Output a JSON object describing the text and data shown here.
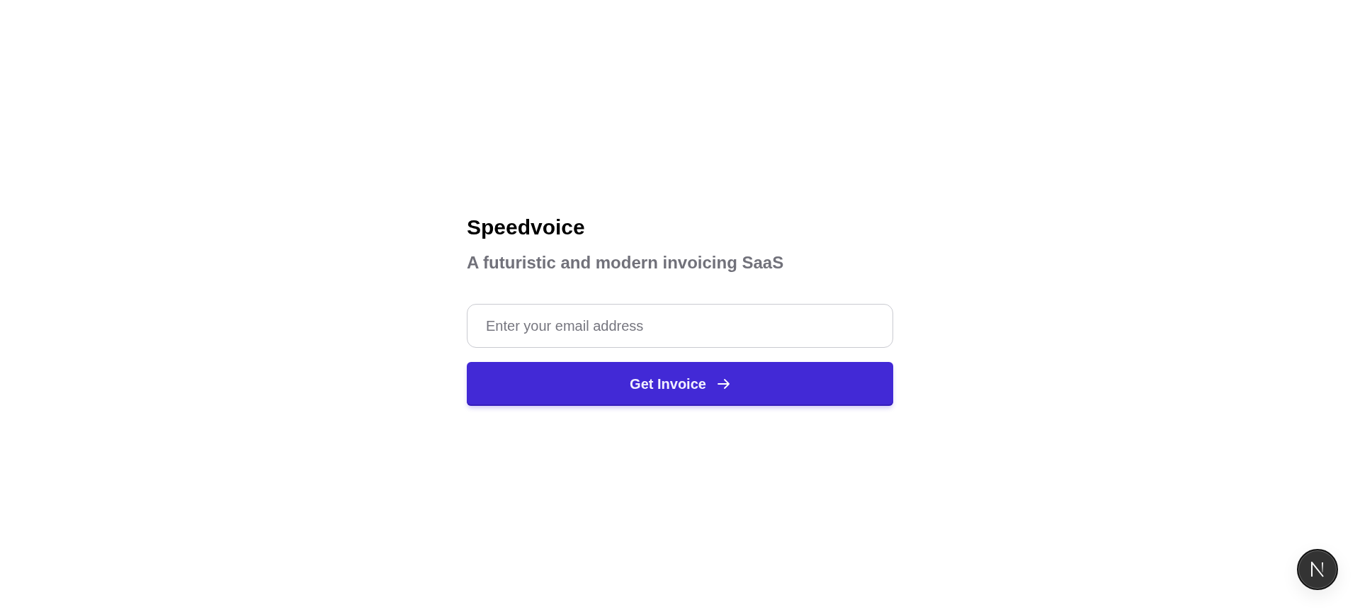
{
  "brand": {
    "title": "Speedvoice",
    "tagline": "A futuristic and modern invoicing SaaS"
  },
  "form": {
    "email": {
      "placeholder": "Enter your email address"
    },
    "submit": {
      "label": "Get Invoice"
    }
  }
}
